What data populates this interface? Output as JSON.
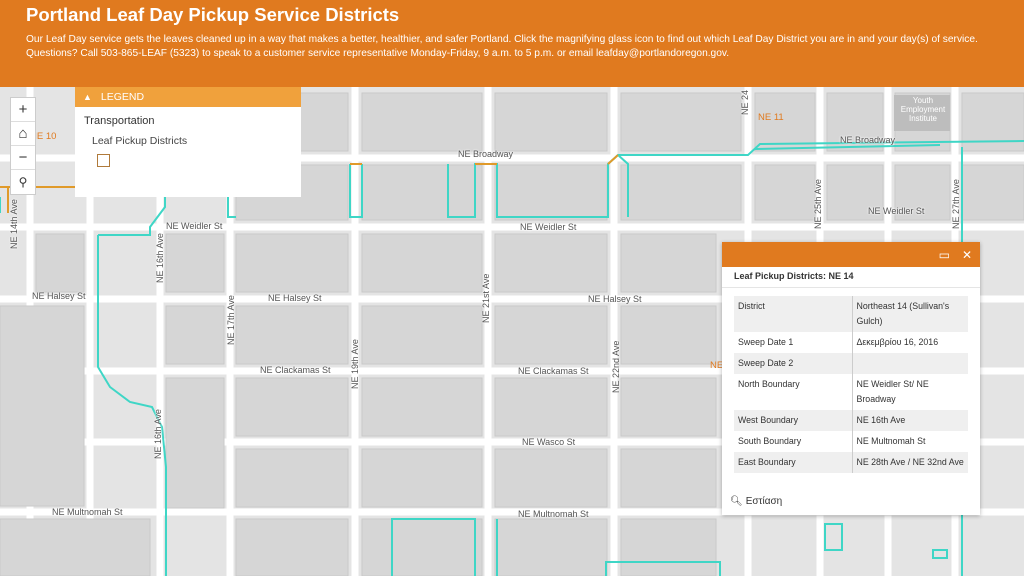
{
  "header": {
    "title": "Portland Leaf Day Pickup Service Districts",
    "description": "Our Leaf Day service gets the leaves cleaned up in a way that makes a better, healthier, and safer Portland. Click the magnifying glass icon to find out which Leaf Day District you are in and your day(s) of service. Questions? Call 503-865-LEAF (5323) to speak to a customer service representative Monday-Friday, 9 a.m. to 5 p.m. or email leafday@portlandoregon.gov."
  },
  "zoom": {
    "plus": "+",
    "home": "⌂",
    "minus": "−",
    "search": "⚲"
  },
  "legend": {
    "title": "LEGEND",
    "layer": "Transportation",
    "sublayer": "Leaf Pickup Districts"
  },
  "map": {
    "streets": {
      "broadway": "NE Broadway",
      "broadway_east": "NE Broadway",
      "weidler": "NE Weidler St",
      "weidler_mid": "NE Weidler St",
      "weidler_east": "NE Weidler St",
      "halsey": "NE Halsey St",
      "halsey_mid": "NE Halsey St",
      "halsey_east": "NE Halsey St",
      "clackamas": "NE Clackamas St",
      "clackamas_mid": "NE Clackamas St",
      "wasco": "NE Wasco St",
      "multnomah": "NE Multnomah St",
      "multnomah_mid": "NE Multnomah St",
      "ave16": "NE 16th Ave",
      "ave16_south": "NE 16th Ave",
      "ave17": "NE 17th Ave",
      "ave19": "NE 19th Ave",
      "ave21": "NE 21st Ave",
      "ave22": "NE 22nd Ave",
      "ave25": "NE 25th Ave",
      "ave27": "NE 27th Ave",
      "ave14": "NE 14th Ave",
      "ave24": "NE 24"
    },
    "districts": {
      "ne10": "NE 10",
      "ne11": "NE 11",
      "ne_partial": "NE"
    },
    "places": {
      "youth": "Youth Employment Institute"
    }
  },
  "popup": {
    "title": "Leaf Pickup Districts: NE 14",
    "rows": [
      {
        "key": "District",
        "value": "Northeast 14 (Sullivan's Gulch)"
      },
      {
        "key": "Sweep Date 1",
        "value": "Δεκεμβρίου 16, 2016"
      },
      {
        "key": "Sweep Date 2",
        "value": ""
      },
      {
        "key": "North Boundary",
        "value": "NE Weidler St/ NE Broadway"
      },
      {
        "key": "West Boundary",
        "value": "NE 16th Ave"
      },
      {
        "key": "South Boundary",
        "value": "NE Multnomah St"
      },
      {
        "key": "East Boundary",
        "value": "NE 28th Ave / NE 32nd Ave"
      }
    ],
    "zoom_label": "Εστίαση"
  },
  "colors": {
    "header": "#e07a1f",
    "legend_header": "#f0a13c",
    "district_outline": "#3fd6c6",
    "district_outline_orange": "#e09a2a"
  }
}
